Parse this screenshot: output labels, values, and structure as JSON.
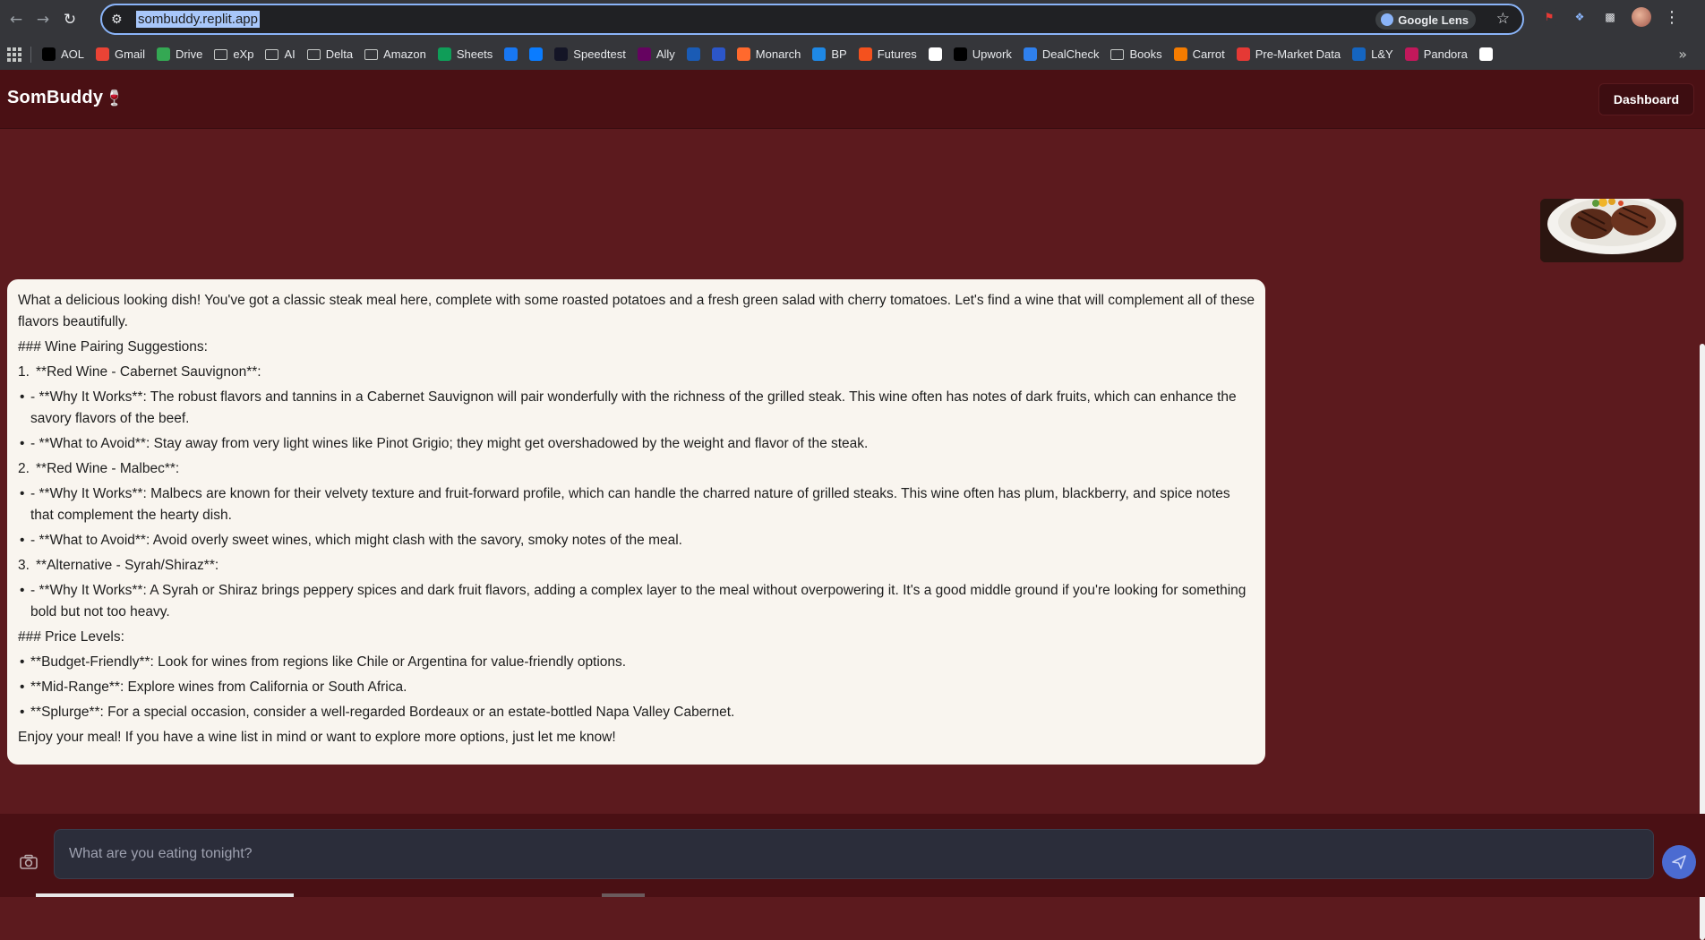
{
  "browser": {
    "url": "sombuddy.replit.app",
    "lens_label": "Google Lens",
    "bookmarks": [
      {
        "label": "AOL",
        "icon": "aol-icon",
        "color": "#000000"
      },
      {
        "label": "Gmail",
        "icon": "gmail-icon",
        "color": "#ea4335"
      },
      {
        "label": "Drive",
        "icon": "drive-icon",
        "color": "#34a853"
      },
      {
        "label": "eXp",
        "icon": "folder-icon",
        "color": ""
      },
      {
        "label": "AI",
        "icon": "folder-icon",
        "color": ""
      },
      {
        "label": "Delta",
        "icon": "folder-icon",
        "color": ""
      },
      {
        "label": "Amazon",
        "icon": "folder-icon",
        "color": ""
      },
      {
        "label": "Sheets",
        "icon": "sheets-icon",
        "color": "#0f9d58"
      },
      {
        "label": "",
        "icon": "facebook-icon",
        "color": "#1877f2"
      },
      {
        "label": "",
        "icon": "messenger-icon",
        "color": "#0a7cff"
      },
      {
        "label": "Speedtest",
        "icon": "speedtest-icon",
        "color": "#141526"
      },
      {
        "label": "Ally",
        "icon": "ally-icon",
        "color": "#650360"
      },
      {
        "label": "",
        "icon": "bank-icon",
        "color": "#1a5bb5"
      },
      {
        "label": "",
        "icon": "chart-icon",
        "color": "#2c56c9"
      },
      {
        "label": "Monarch",
        "icon": "monarch-icon",
        "color": "#ff692d"
      },
      {
        "label": "BP",
        "icon": "bp-icon",
        "color": "#1e88e5"
      },
      {
        "label": "Futures",
        "icon": "futures-icon",
        "color": "#f4511e"
      },
      {
        "label": "",
        "icon": "slash-icon",
        "color": "#ffffff"
      },
      {
        "label": "Upwork",
        "icon": "upwork-icon",
        "color": "#000000"
      },
      {
        "label": "DealCheck",
        "icon": "dealcheck-icon",
        "color": "#2f80ed"
      },
      {
        "label": "Books",
        "icon": "folder-icon",
        "color": ""
      },
      {
        "label": "Carrot",
        "icon": "carrot-icon",
        "color": "#f57c00"
      },
      {
        "label": "Pre-Market Data",
        "icon": "market-icon",
        "color": "#e53935"
      },
      {
        "label": "L&Y",
        "icon": "ly-icon",
        "color": "#1565c0"
      },
      {
        "label": "Pandora",
        "icon": "pandora-icon",
        "color": "#c2185b"
      },
      {
        "label": "",
        "icon": "circle-icon",
        "color": "#ffffff"
      }
    ]
  },
  "app": {
    "logo": "SomBuddy",
    "logo_glyph": "🍷",
    "dashboard_label": "Dashboard"
  },
  "message": {
    "intro": "What a delicious looking dish! You've got a classic steak meal here, complete with some roasted potatoes and a fresh green salad with cherry tomatoes. Let's find a wine that will complement all of these flavors beautifully.",
    "heading1": "### Wine Pairing Suggestions:",
    "item1": {
      "num": "1.",
      "text": "**Red Wine - Cabernet Sauvignon**:"
    },
    "item1_b1": "- **Why It Works**: The robust flavors and tannins in a Cabernet Sauvignon will pair wonderfully with the richness of the grilled steak. This wine often has notes of dark fruits, which can enhance the savory flavors of the beef.",
    "item1_b2": "- **What to Avoid**: Stay away from very light wines like Pinot Grigio; they might get overshadowed by the weight and flavor of the steak.",
    "item2": {
      "num": "2.",
      "text": "**Red Wine - Malbec**:"
    },
    "item2_b1": "- **Why It Works**: Malbecs are known for their velvety texture and fruit-forward profile, which can handle the charred nature of grilled steaks. This wine often has plum, blackberry, and spice notes that complement the hearty dish.",
    "item2_b2": "- **What to Avoid**: Avoid overly sweet wines, which might clash with the savory, smoky notes of the meal.",
    "item3": {
      "num": "3.",
      "text": "**Alternative - Syrah/Shiraz**:"
    },
    "item3_b1": "- **Why It Works**: A Syrah or Shiraz brings peppery spices and dark fruit flavors, adding a complex layer to the meal without overpowering it. It's a good middle ground if you're looking for something bold but not too heavy.",
    "heading2": "### Price Levels:",
    "price1": "**Budget-Friendly**: Look for wines from regions like Chile or Argentina for value-friendly options.",
    "price2": "**Mid-Range**: Explore wines from California or South Africa.",
    "price3": "**Splurge**: For a special occasion, consider a well-regarded Bordeaux or an estate-bottled Napa Valley Cabernet.",
    "outro": "Enjoy your meal! If you have a wine list in mind or want to explore more options, just let me know!",
    "bullet": "•"
  },
  "composer": {
    "placeholder": "What are you eating tonight?"
  },
  "colors": {
    "page_bg": "#5c1a1e",
    "header_bg": "#4a1014",
    "bubble_bg": "#f9f5ef",
    "send_button": "#4b6bd1"
  }
}
